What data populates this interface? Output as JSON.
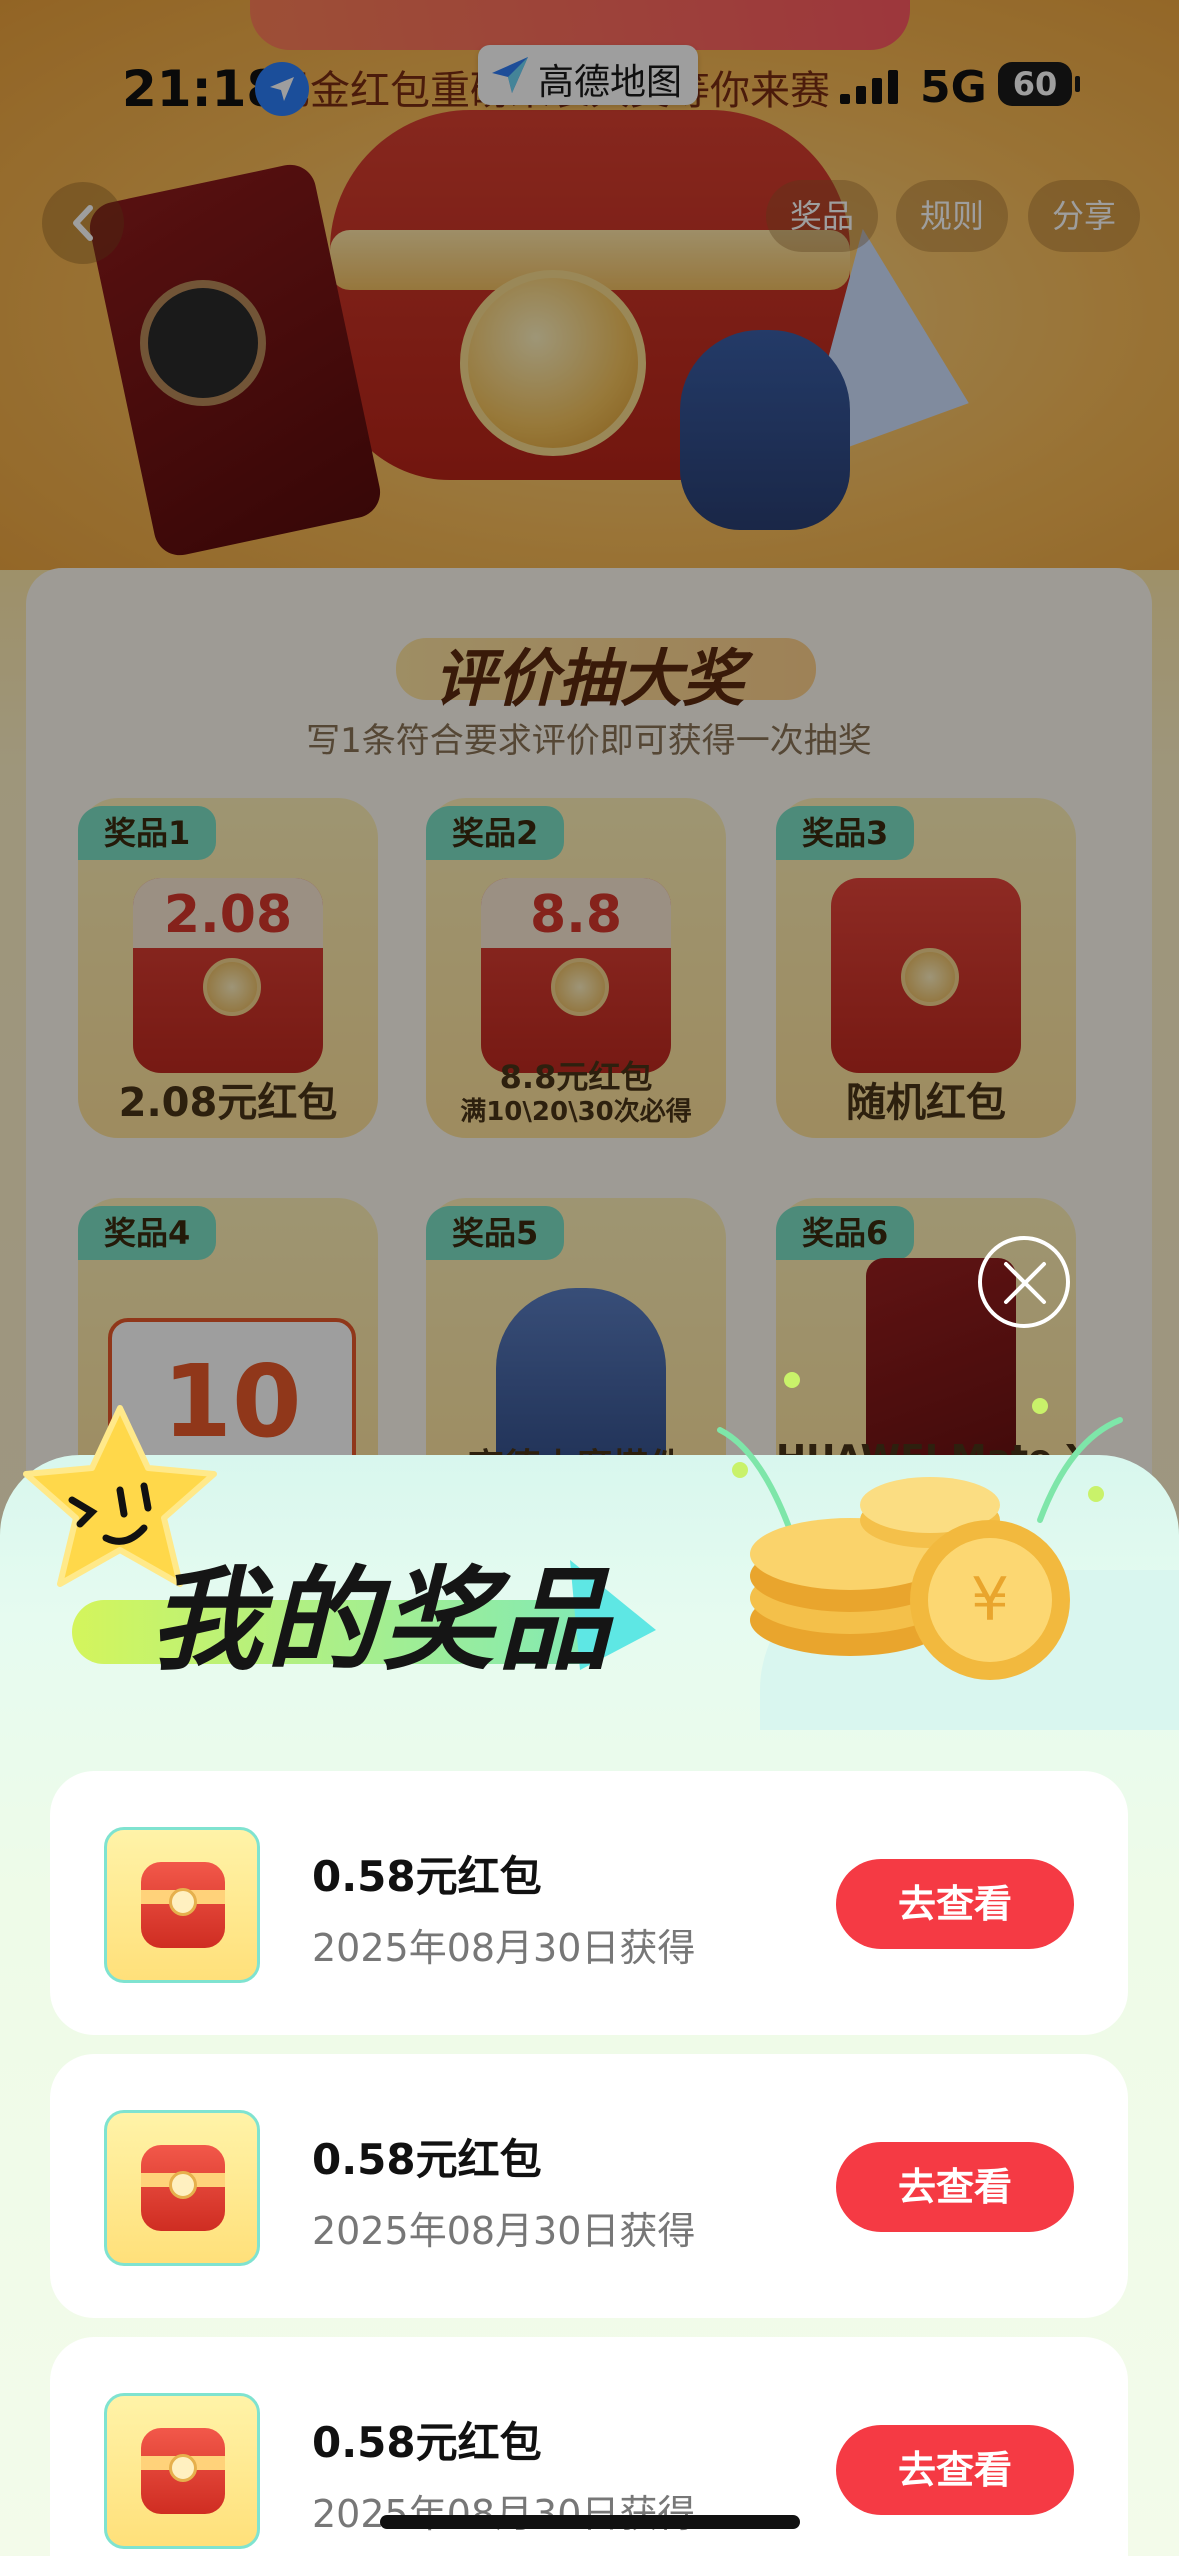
{
  "status_bar": {
    "time": "21:18",
    "app_name": "高德地图",
    "network": "5G",
    "battery": "60"
  },
  "hero": {
    "subtitle": "现金红包重磅来袭大奖等你来赛"
  },
  "top_nav": {
    "prizes_label": "奖品",
    "rules_label": "规则",
    "share_label": "分享"
  },
  "panel": {
    "title": "评价抽大奖",
    "subtitle": "写1条符合要求评价即可获得一次抽奖",
    "prizes": [
      {
        "tag": "奖品1",
        "packet_text": "2.08",
        "name": "2.08元红包"
      },
      {
        "tag": "奖品2",
        "packet_text": "8.8",
        "name": "8.8元红包",
        "note": "满10\\20\\30次必得"
      },
      {
        "tag": "奖品3",
        "name": "随机红包"
      },
      {
        "tag": "奖品4",
        "coupon_text": "10"
      },
      {
        "tag": "奖品5",
        "name": "高德小魔搭件"
      },
      {
        "tag": "奖品6",
        "name": "HUAWEI Mate XT"
      }
    ]
  },
  "sheet": {
    "title": "我的奖品",
    "items": [
      {
        "title": "0.58元红包",
        "date": "2025年08月30日获得",
        "button": "去查看"
      },
      {
        "title": "0.58元红包",
        "date": "2025年08月30日获得",
        "button": "去查看"
      },
      {
        "title": "0.58元红包",
        "date": "2025年08月30日获得",
        "button": "去查看"
      }
    ]
  },
  "colors": {
    "accent_red": "#f53a44",
    "sheet_mint": "#d8f7ee",
    "tag_teal": "#7de0c6"
  }
}
